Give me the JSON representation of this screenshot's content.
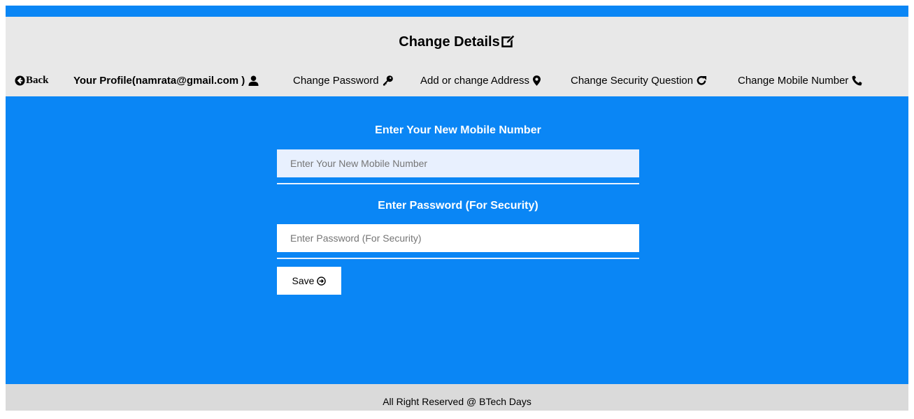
{
  "header": {
    "title": "Change Details"
  },
  "nav": {
    "back": "Back",
    "profile": "Your Profile(namrata@gmail.com )",
    "change_password": "Change Password",
    "address": "Add or change Address",
    "security_question": "Change Security Question",
    "mobile": "Change Mobile Number"
  },
  "form": {
    "mobile_label": "Enter Your New Mobile Number",
    "mobile_placeholder": "Enter Your New Mobile Number",
    "mobile_value": "",
    "password_label": "Enter Password (For Security)",
    "password_placeholder": "Enter Password (For Security)",
    "password_value": "",
    "save_label": "Save"
  },
  "footer": {
    "text": "All Right Reserved @ BTech Days"
  },
  "colors": {
    "accent": "#0a86f5",
    "header_bg": "#e8e8e8",
    "footer_bg": "#dadada"
  },
  "icons": {
    "title": "edit-icon",
    "back": "arrow-circle-left-icon",
    "profile": "user-icon",
    "change_password": "key-icon",
    "address": "map-marker-icon",
    "security_question": "redo-icon",
    "mobile": "phone-icon",
    "save": "arrow-circle-right-icon"
  }
}
